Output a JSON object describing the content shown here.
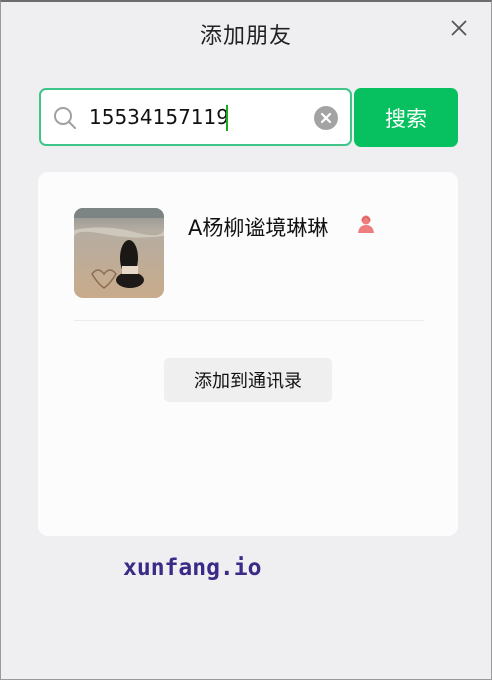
{
  "window": {
    "title": "添加朋友"
  },
  "icons": {
    "close": "close-icon",
    "search": "search-icon",
    "clear": "clear-circle-icon",
    "gender": "female-icon"
  },
  "search": {
    "value": "15534157119",
    "placeholder": "",
    "button_label": "搜索"
  },
  "result": {
    "name": "A杨柳谧境琳琳",
    "add_button_label": "添加到通讯录"
  },
  "watermark": {
    "text": "xunfang.io"
  },
  "colors": {
    "accent": "#07c160",
    "focus_border": "#3fc58a",
    "gender": "#ee7d7d",
    "watermark": "#3b2a86"
  }
}
